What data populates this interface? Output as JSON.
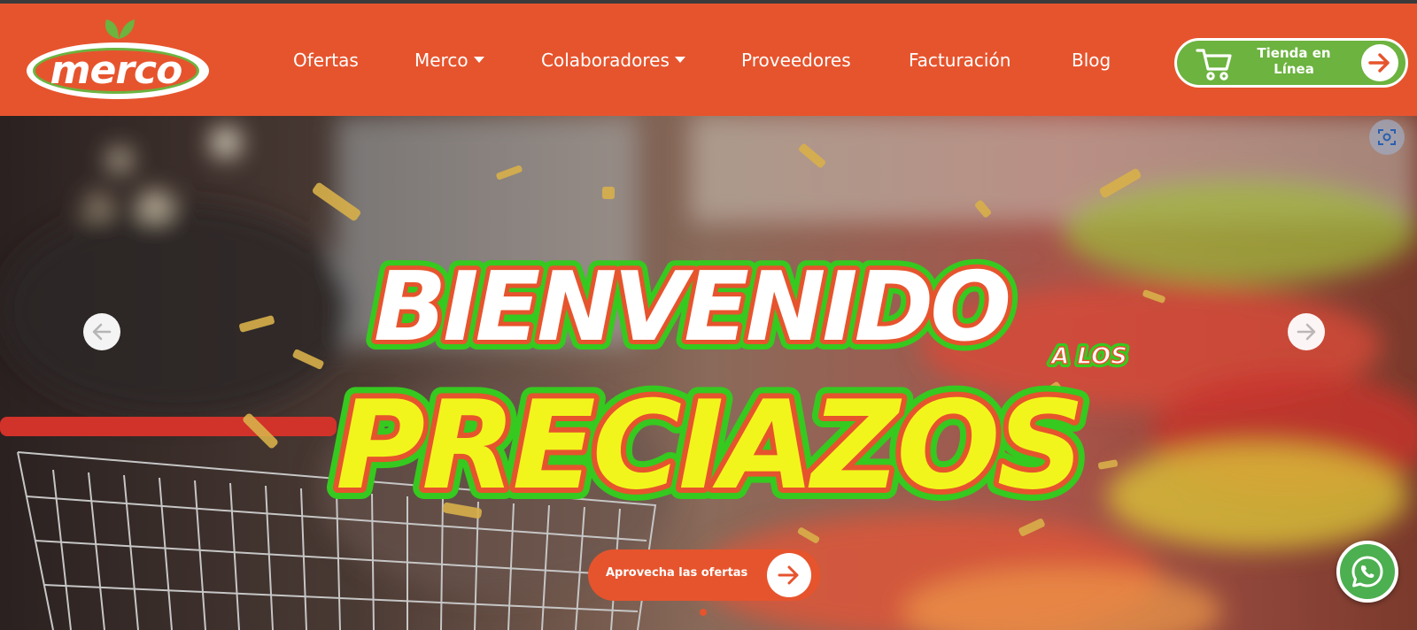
{
  "brand": {
    "logo_text": "merco"
  },
  "nav": {
    "items": [
      {
        "label": "Ofertas",
        "dropdown": false
      },
      {
        "label": "Merco",
        "dropdown": true
      },
      {
        "label": "Colaboradores",
        "dropdown": true
      },
      {
        "label": "Proveedores",
        "dropdown": false
      },
      {
        "label": "Facturación",
        "dropdown": false
      },
      {
        "label": "Blog",
        "dropdown": false
      }
    ],
    "shop_button": {
      "line1": "Tienda en",
      "line2": "Línea"
    }
  },
  "hero": {
    "headline_top": "BIENVENIDO",
    "headline_small": "A LOS",
    "headline_bottom": "PRECIAZOS",
    "cta_label": "Aprovecha las ofertas",
    "active_slide": 1,
    "slide_count": 1
  },
  "colors": {
    "brand_orange": "#e6542d",
    "brand_green": "#6cb33f",
    "headline_yellow": "#f2f51c",
    "whatsapp_green": "#4caf50"
  },
  "icons": [
    "cart-icon",
    "arrow-right-icon",
    "arrow-left-icon",
    "scan-icon",
    "whatsapp-icon",
    "leaf-icon"
  ]
}
